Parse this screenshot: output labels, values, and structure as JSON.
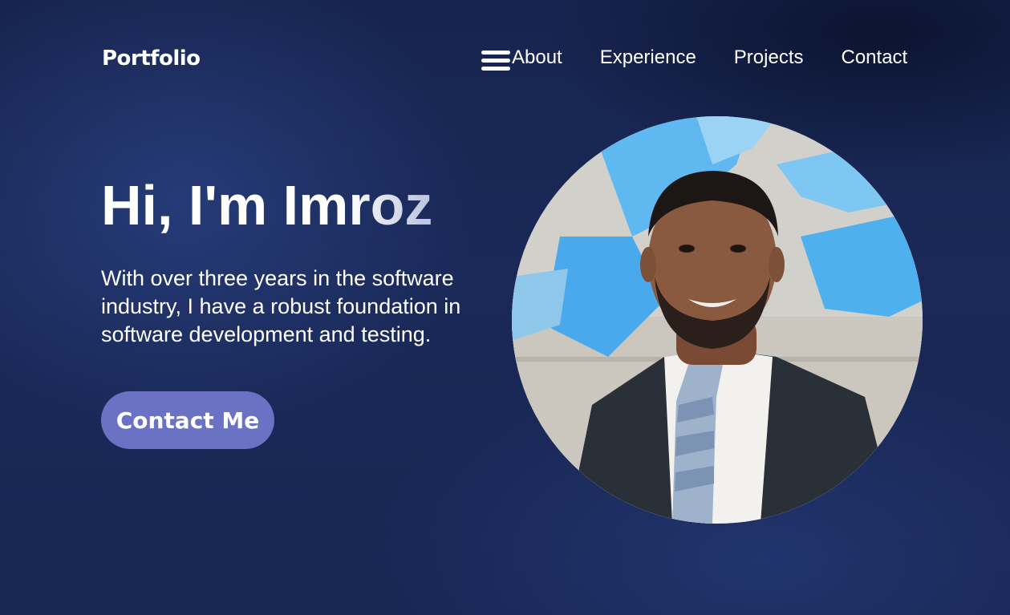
{
  "nav": {
    "logo": "Portfolio",
    "menu_icon": "hamburger-menu-icon",
    "links": [
      {
        "label": "About"
      },
      {
        "label": "Experience"
      },
      {
        "label": "Projects"
      },
      {
        "label": "Contact"
      }
    ]
  },
  "hero": {
    "title": "Hi, I'm Imroz",
    "description": "With over three years in the software industry, I have a robust foundation in software development and testing.",
    "cta_label": "Contact Me",
    "photo_alt": "profile-photo"
  },
  "colors": {
    "background": "#1a2958",
    "button": "#6b72c4",
    "text": "#ffffff"
  }
}
